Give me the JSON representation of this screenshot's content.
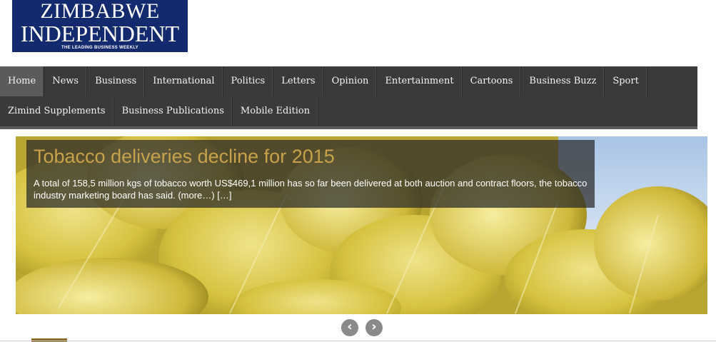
{
  "logo": {
    "line1": "ZIMBABWE",
    "line2": "INDEPENDENT",
    "tagline": "THE LEADING BUSINESS WEEKLY"
  },
  "nav": {
    "row1": [
      "Home",
      "News",
      "Business",
      "International",
      "Politics",
      "Letters",
      "Opinion",
      "Entertainment",
      "Cartoons",
      "Business Buzz",
      "Sport"
    ],
    "row2": [
      "Zimind Supplements",
      "Business Publications",
      "Mobile Edition"
    ],
    "active": "Home"
  },
  "slider": {
    "title": "Tobacco deliveries decline for 2015",
    "summary": "A total of 158,5 million kgs of tobacco worth US$469,1 million has so far been delivered at both auction and contract floors, the tobacco industry marketing board has said. (more…) […]",
    "prev_icon": "chevron-left-icon",
    "next_icon": "chevron-right-icon"
  },
  "colors": {
    "logo_bg": "#142a6e",
    "nav_bg": "#3a3a3a",
    "title": "#c7a24a"
  }
}
